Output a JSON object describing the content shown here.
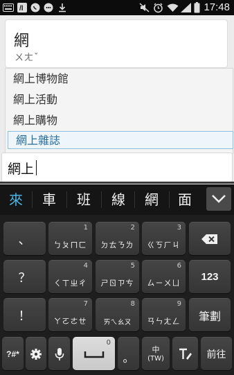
{
  "status_bar": {
    "time": "17:48",
    "icons": [
      "keyboard-icon",
      "app-icon",
      "whatsapp-icon",
      "chat-icon",
      "download-icon",
      "mute-icon",
      "alarm-icon",
      "wifi-icon",
      "signal-icon",
      "battery-icon"
    ]
  },
  "card": {
    "char": "網",
    "phonetic": "ㄨㄤˇ"
  },
  "suggestions": [
    "網上博物館",
    "網上活動",
    "網上購物",
    "網上雜誌"
  ],
  "input": {
    "value": "網上"
  },
  "candidates": [
    "來",
    "車",
    "班",
    "線",
    "網",
    "面"
  ],
  "keyboard": {
    "row1": [
      {
        "num": "",
        "label": "、"
      },
      {
        "num": "1",
        "label": "ㄅㄆㄇㄈ"
      },
      {
        "num": "2",
        "label": "ㄉㄊㄋㄌ"
      },
      {
        "num": "3",
        "label": "ㄍㄎㄏㄐ"
      }
    ],
    "row2": [
      {
        "num": "",
        "label": "？"
      },
      {
        "num": "4",
        "label": "ㄑㄒㄓㄔ"
      },
      {
        "num": "5",
        "label": "ㄕㄖㄗㄘ"
      },
      {
        "num": "6",
        "label": "ㄙㄧㄨㄩ"
      },
      {
        "num": "",
        "label": "123"
      }
    ],
    "row3": [
      {
        "num": "",
        "label": "！"
      },
      {
        "num": "7",
        "label": "ㄚㄛㄜㄝ"
      },
      {
        "num": "8",
        "label": "ㄞㄟㄠㄡ"
      },
      {
        "num": "9",
        "label": "ㄢㄣㄤㄥ"
      },
      {
        "num": "",
        "label": "筆劃"
      }
    ],
    "row4": {
      "symbols": "?#*",
      "space_num": "0",
      "period": "。",
      "lang_top": "中",
      "lang_bottom": "(TW)",
      "enter": "前往"
    }
  },
  "colors": {
    "candidate_highlight": "#4fb2e2",
    "selected_suggestion": "#2a6f9b"
  }
}
